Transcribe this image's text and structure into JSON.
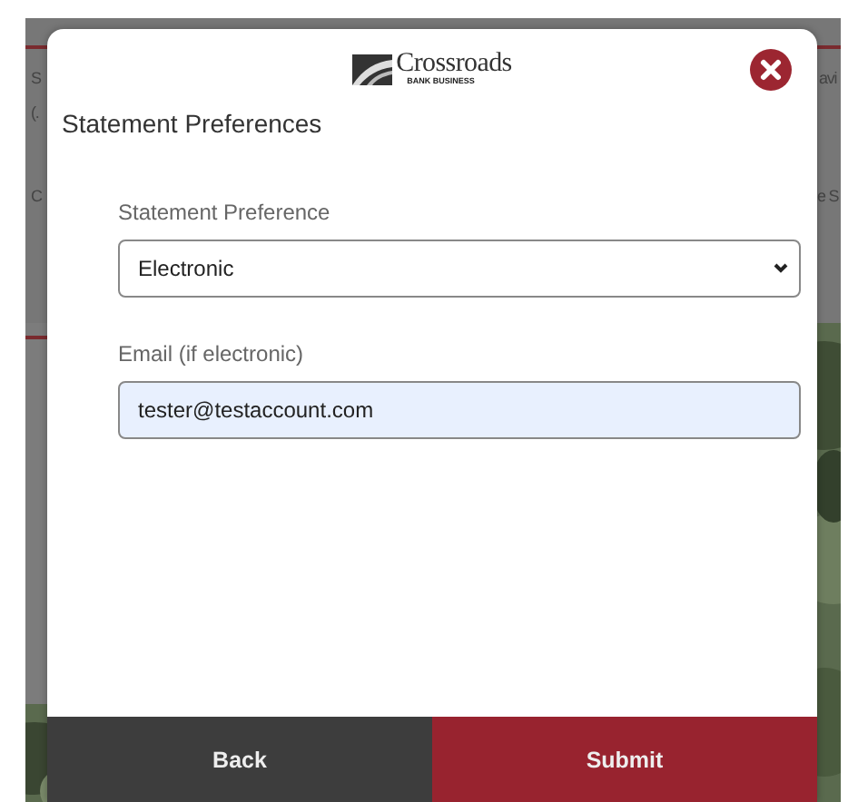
{
  "backdrop": {
    "left_fragments": [
      "S",
      "(.",
      "C"
    ],
    "right_fragments": [
      "avi",
      "e S"
    ]
  },
  "dialog": {
    "logo": {
      "name": "Crossroads",
      "tagline": "BANK BUSINESS"
    },
    "title": "Statement Preferences",
    "fields": [
      {
        "kind": "select",
        "label": "Statement Preference",
        "value": "Electronic"
      },
      {
        "kind": "text",
        "label": "Email (if electronic)",
        "value": "tester@testaccount.com"
      }
    ],
    "buttons": [
      {
        "kind": "secondary",
        "label": "Back"
      },
      {
        "kind": "primary",
        "label": "Submit"
      }
    ]
  }
}
